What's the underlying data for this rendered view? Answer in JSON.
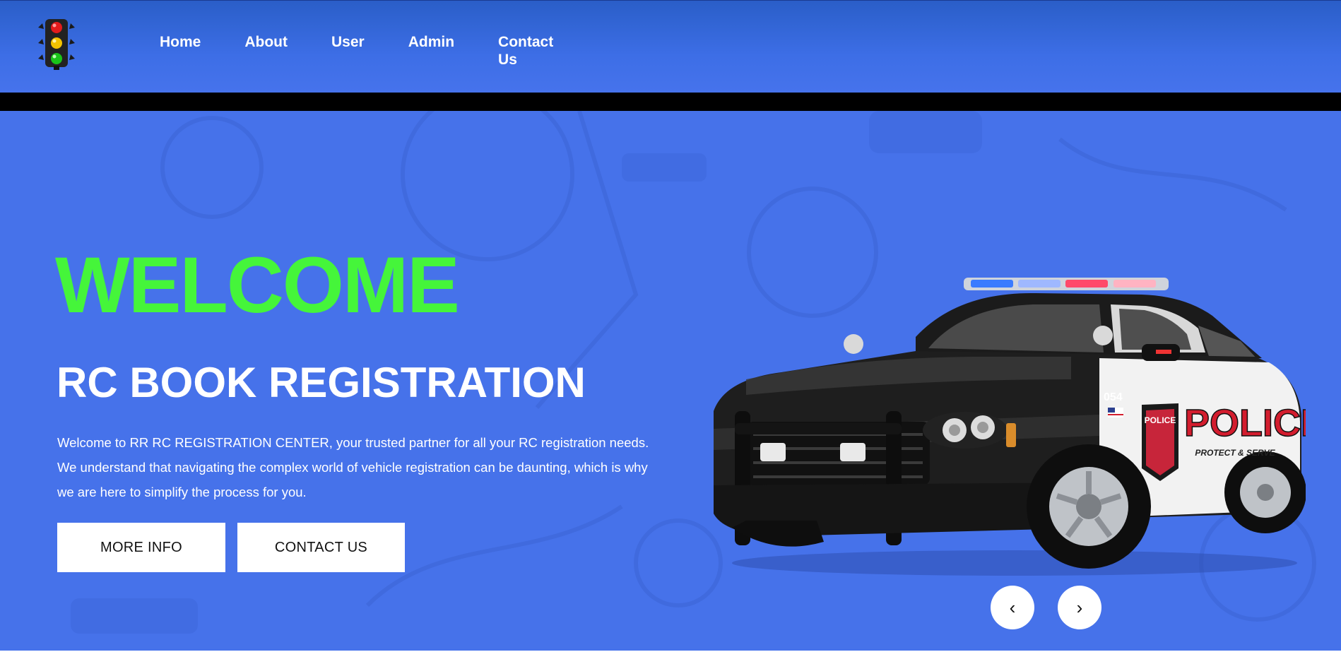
{
  "nav": {
    "items": [
      "Home",
      "About",
      "User",
      "Admin",
      "Contact Us"
    ]
  },
  "hero": {
    "welcome": "WELCOME",
    "subtitle": "RC BOOK REGISTRATION",
    "description": "Welcome to RR RC REGISTRATION CENTER, your trusted partner for all your RC registration needs. We understand that navigating the complex world of vehicle registration can be daunting, which is why we are here to simplify the process for you.",
    "more_info_label": "MORE INFO",
    "contact_label": "CONTACT US"
  },
  "car": {
    "unit_number": "054",
    "brand_text": "POLICE",
    "slogan": "PROTECT & SERVE"
  },
  "slider": {
    "prev_icon": "‹",
    "next_icon": "›"
  },
  "icons": {
    "logo": "traffic-light-icon",
    "prev": "chevron-left-icon",
    "next": "chevron-right-icon"
  },
  "colors": {
    "header_bg": "#3d6ee6",
    "hero_bg": "#4672ea",
    "welcome_green": "#45f53a",
    "button_bg": "#ffffff"
  }
}
